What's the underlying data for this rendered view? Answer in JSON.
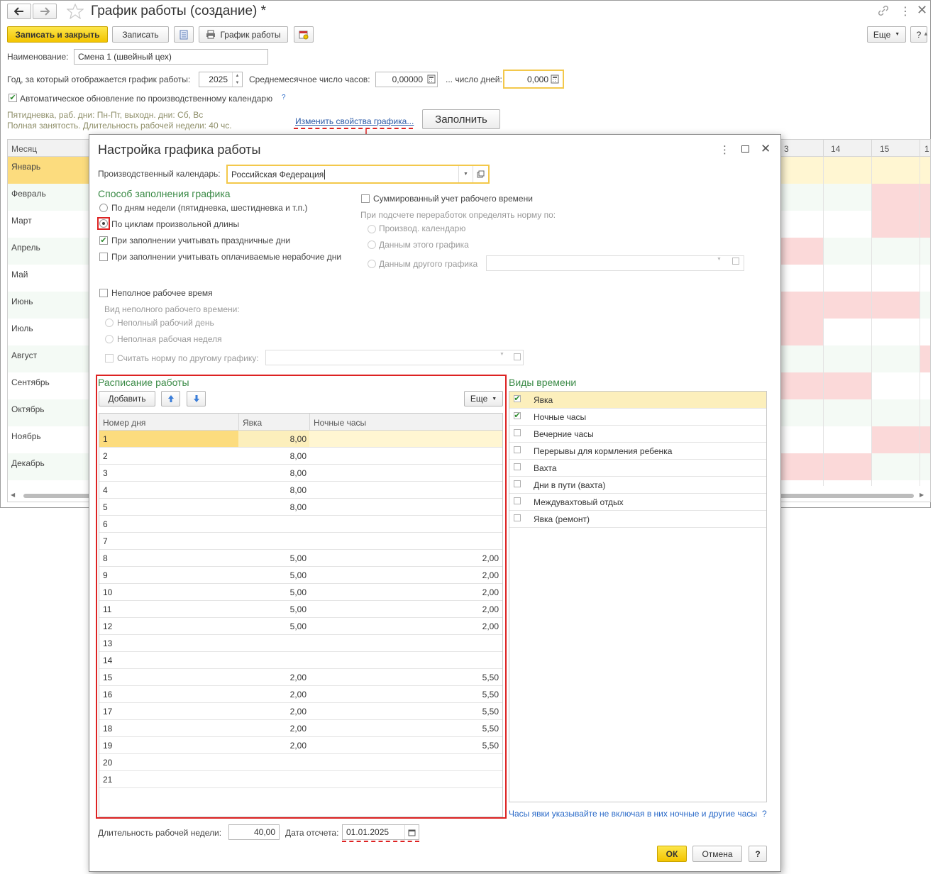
{
  "main": {
    "title": "График работы (создание) *",
    "toolbar": {
      "save_close": "Записать и закрыть",
      "save": "Записать",
      "schedule": "График работы",
      "more": "Еще",
      "help": "?"
    },
    "name_label": "Наименование:",
    "name_value": "Смена 1 (швейный цех)",
    "year_label": "Год, за который отображается график работы:",
    "year_value": "2025",
    "avg_hours_label": "Среднемесячное число часов:",
    "avg_hours_value": "0,00000",
    "days_label": "... число дней:",
    "days_value": "0,000",
    "auto_update_label": "Автоматическое обновление по производственному календарю",
    "auto_update_checked": true,
    "help_q": "?",
    "info_line1": "Пятидневка, раб. дни: Пн-Пт, выходн. дни: Сб, Вс",
    "info_line2": "Полная занятость. Длительность рабочей недели: 40 чс.",
    "change_props_link": "Изменить свойства графика...",
    "fill_button": "Заполнить",
    "grid": {
      "month_header": "Месяц",
      "day_headers": [
        "3",
        "14",
        "15",
        "1"
      ],
      "months": [
        "Январь",
        "Февраль",
        "Март",
        "Апрель",
        "Май",
        "Июнь",
        "Июль",
        "Август",
        "Сентябрь",
        "Октябрь",
        "Ноябрь",
        "Декабрь"
      ]
    }
  },
  "dialog": {
    "title": "Настройка графика работы",
    "calendar_label": "Производственный календарь:",
    "calendar_value": "Российская Федерация",
    "fill_method_title": "Способ заполнения графика",
    "radio_weekdays": "По дням недели (пятидневка, шестидневка и т.п.)",
    "radio_cycles": "По циклам произвольной длины",
    "cb_holidays": "При заполнении учитывать праздничные дни",
    "cb_paid_nonwork": "При заполнении учитывать оплачиваемые нерабочие дни",
    "cb_summarized": "Суммированный учет рабочего времени",
    "overtime_label": "При подсчете переработок определять норму по:",
    "radio_prod_cal": "Производ. календарю",
    "radio_this_sched": "Данным этого графика",
    "radio_other_sched": "Данным другого графика",
    "cb_parttime": "Неполное рабочее время",
    "parttime_kind_label": "Вид неполного рабочего времени:",
    "radio_part_day": "Неполный рабочий день",
    "radio_part_week": "Неполная рабочая неделя",
    "cb_norm_other": "Считать норму по другому графику:",
    "schedule_title": "Расписание работы",
    "add_button": "Добавить",
    "more_button": "Еще",
    "columns": [
      "Номер дня",
      "Явка",
      "Ночные часы"
    ],
    "rows": [
      {
        "day": "1",
        "yavka": "8,00",
        "night": ""
      },
      {
        "day": "2",
        "yavka": "8,00",
        "night": ""
      },
      {
        "day": "3",
        "yavka": "8,00",
        "night": ""
      },
      {
        "day": "4",
        "yavka": "8,00",
        "night": ""
      },
      {
        "day": "5",
        "yavka": "8,00",
        "night": ""
      },
      {
        "day": "6",
        "yavka": "",
        "night": ""
      },
      {
        "day": "7",
        "yavka": "",
        "night": ""
      },
      {
        "day": "8",
        "yavka": "5,00",
        "night": "2,00"
      },
      {
        "day": "9",
        "yavka": "5,00",
        "night": "2,00"
      },
      {
        "day": "10",
        "yavka": "5,00",
        "night": "2,00"
      },
      {
        "day": "11",
        "yavka": "5,00",
        "night": "2,00"
      },
      {
        "day": "12",
        "yavka": "5,00",
        "night": "2,00"
      },
      {
        "day": "13",
        "yavka": "",
        "night": ""
      },
      {
        "day": "14",
        "yavka": "",
        "night": ""
      },
      {
        "day": "15",
        "yavka": "2,00",
        "night": "5,50"
      },
      {
        "day": "16",
        "yavka": "2,00",
        "night": "5,50"
      },
      {
        "day": "17",
        "yavka": "2,00",
        "night": "5,50"
      },
      {
        "day": "18",
        "yavka": "2,00",
        "night": "5,50"
      },
      {
        "day": "19",
        "yavka": "2,00",
        "night": "5,50"
      },
      {
        "day": "20",
        "yavka": "",
        "night": ""
      },
      {
        "day": "21",
        "yavka": "",
        "night": ""
      }
    ],
    "time_types_title": "Виды времени",
    "time_types": [
      {
        "label": "Явка",
        "checked": true
      },
      {
        "label": "Ночные часы",
        "checked": true
      },
      {
        "label": "Вечерние часы",
        "checked": false
      },
      {
        "label": "Перерывы для кормления ребенка",
        "checked": false
      },
      {
        "label": "Вахта",
        "checked": false
      },
      {
        "label": "Дни в пути (вахта)",
        "checked": false
      },
      {
        "label": "Междувахтовый отдых",
        "checked": false
      },
      {
        "label": "Явка (ремонт)",
        "checked": false
      }
    ],
    "hint": "Часы явки указывайте не включая в них ночные и другие часы",
    "hint_q": "?",
    "week_length_label": "Длительность рабочей недели:",
    "week_length_value": "40,00",
    "ref_date_label": "Дата отсчета:",
    "ref_date_value": "01.01.2025",
    "ok": "ОК",
    "cancel": "Отмена",
    "help": "?"
  }
}
